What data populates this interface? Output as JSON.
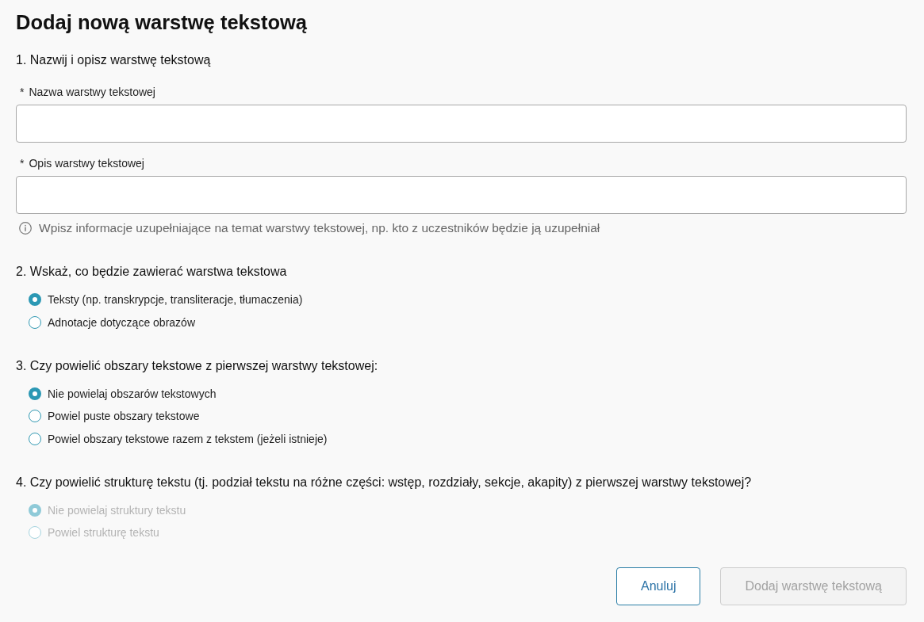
{
  "title": "Dodaj nową warstwę tekstową",
  "sections": [
    {
      "kind": "fields",
      "heading": "1. Nazwij i opisz warstwę tekstową",
      "fields": [
        {
          "mark": "*",
          "label": "Nazwa warstwy tekstowej"
        },
        {
          "mark": "*",
          "label": "Opis warstwy tekstowej",
          "hint": "Wpisz informacje uzupełniające na temat warstwy tekstowej, np. kto z uczestników będzie ją uzupełniał"
        }
      ]
    },
    {
      "kind": "choice",
      "heading": "2. Wskaż, co będzie zawierać warstwa tekstowa",
      "options": [
        {
          "label": "Teksty (np. transkrypcje, transliteracje, tłumaczenia)",
          "selected": true,
          "disabled": false
        },
        {
          "label": "Adnotacje dotyczące obrazów",
          "selected": false,
          "disabled": false
        }
      ]
    },
    {
      "kind": "choice",
      "heading": "3. Czy powielić obszary tekstowe z pierwszej warstwy tekstowej:",
      "options": [
        {
          "label": "Nie powielaj obszarów tekstowych",
          "selected": true,
          "disabled": false
        },
        {
          "label": "Powiel puste obszary tekstowe",
          "selected": false,
          "disabled": false
        },
        {
          "label": "Powiel obszary tekstowe razem z tekstem (jeżeli istnieje)",
          "selected": false,
          "disabled": false
        }
      ]
    },
    {
      "kind": "choice",
      "heading": "4. Czy powielić strukturę tekstu (tj. podział tekstu na różne części: wstęp, rozdziały, sekcje, akapity) z pierwszej warstwy tekstowej?",
      "options": [
        {
          "label": "Nie powielaj struktury tekstu",
          "selected": true,
          "disabled": true
        },
        {
          "label": "Powiel strukturę tekstu",
          "selected": false,
          "disabled": true
        }
      ]
    }
  ],
  "buttons": [
    {
      "label": "Anuluj",
      "kind": "secondary",
      "disabled": false
    },
    {
      "label": "Dodaj warstwę tekstową",
      "kind": "primary",
      "disabled": true
    }
  ]
}
